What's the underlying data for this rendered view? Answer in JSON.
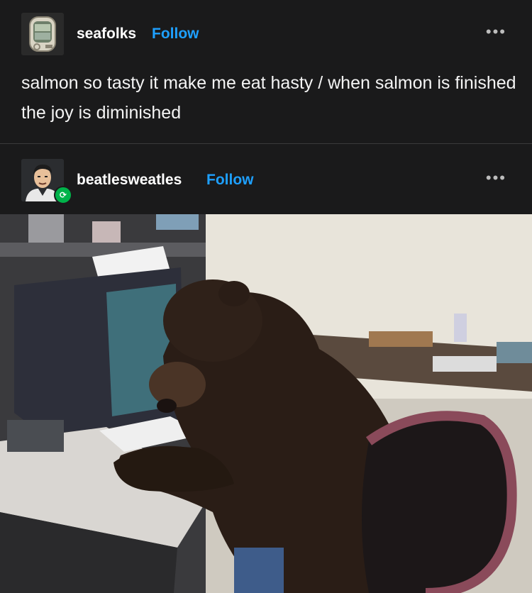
{
  "posts": [
    {
      "username": "seafolks",
      "follow_label": "Follow",
      "more_label": "•••",
      "avatar_icon": "sardine-tin-icon",
      "text": "salmon so tasty it make me eat hasty / when salmon is finished the joy is diminished"
    },
    {
      "username": "beatlesweatles",
      "follow_label": "Follow",
      "more_label": "•••",
      "avatar_icon": "cartoon-man-avatar",
      "reblog_icon": "reblog-icon",
      "reblog_glyph": "⟳"
    }
  ],
  "colors": {
    "background": "#1a1a1b",
    "follow_blue": "#1ea0ff",
    "reblog_green": "#00b34a"
  }
}
